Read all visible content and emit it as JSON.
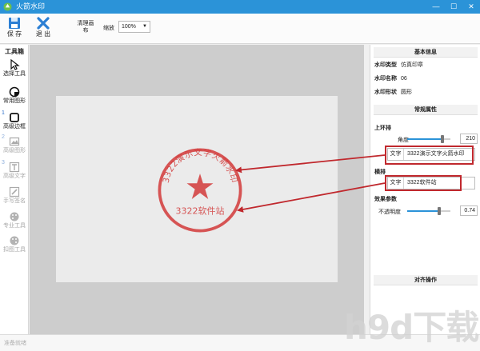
{
  "app": {
    "title": "火箭水印"
  },
  "toolbar": {
    "save_label": "保 存",
    "exit_label": "退 出",
    "clear_label": "清理画布",
    "zoom_label": "缩放",
    "zoom_value": "100%"
  },
  "toolbox": {
    "header": "工具箱",
    "tools": [
      {
        "label": "选择工具",
        "num": ""
      },
      {
        "label": "常用图形",
        "num": ""
      },
      {
        "label": "高级边框",
        "num": "1"
      },
      {
        "label": "高级图形",
        "num": "2"
      },
      {
        "label": "高级文字",
        "num": "3"
      },
      {
        "label": "手写签名",
        "num": ""
      },
      {
        "label": "专业工具",
        "num": ""
      },
      {
        "label": "扣图工具",
        "num": ""
      }
    ]
  },
  "stamp": {
    "top_text": "3322演示文字火箭水印",
    "bottom_text": "3322软件站",
    "color": "#d23a3a"
  },
  "panel": {
    "basic_header": "基本信息",
    "type_label": "水印类型",
    "type_value": "仿真印章",
    "name_label": "水印名称",
    "name_value": "06",
    "shape_label": "水印形状",
    "shape_value": "圆形",
    "props_header": "常规属性",
    "top_ring_label": "上环排",
    "angle_label": "角度",
    "angle_value": "210",
    "angle_fraction": 0.82,
    "text_key": "文字",
    "top_text_value": "3322演示文字火箭水印",
    "horizontal_label": "横排",
    "horizontal_text_value": "3322软件站",
    "effect_label": "效果参数",
    "opacity_label": "不透明度",
    "opacity_value": "0.74",
    "opacity_fraction": 0.74,
    "align_header": "对齐操作"
  },
  "status": {
    "text": "准备就绪"
  },
  "watermark": {
    "text": "h9d下载"
  },
  "colors": {
    "titlebar": "#2b93d8",
    "annotation": "#c0282d",
    "accent": "#2b93d8"
  }
}
